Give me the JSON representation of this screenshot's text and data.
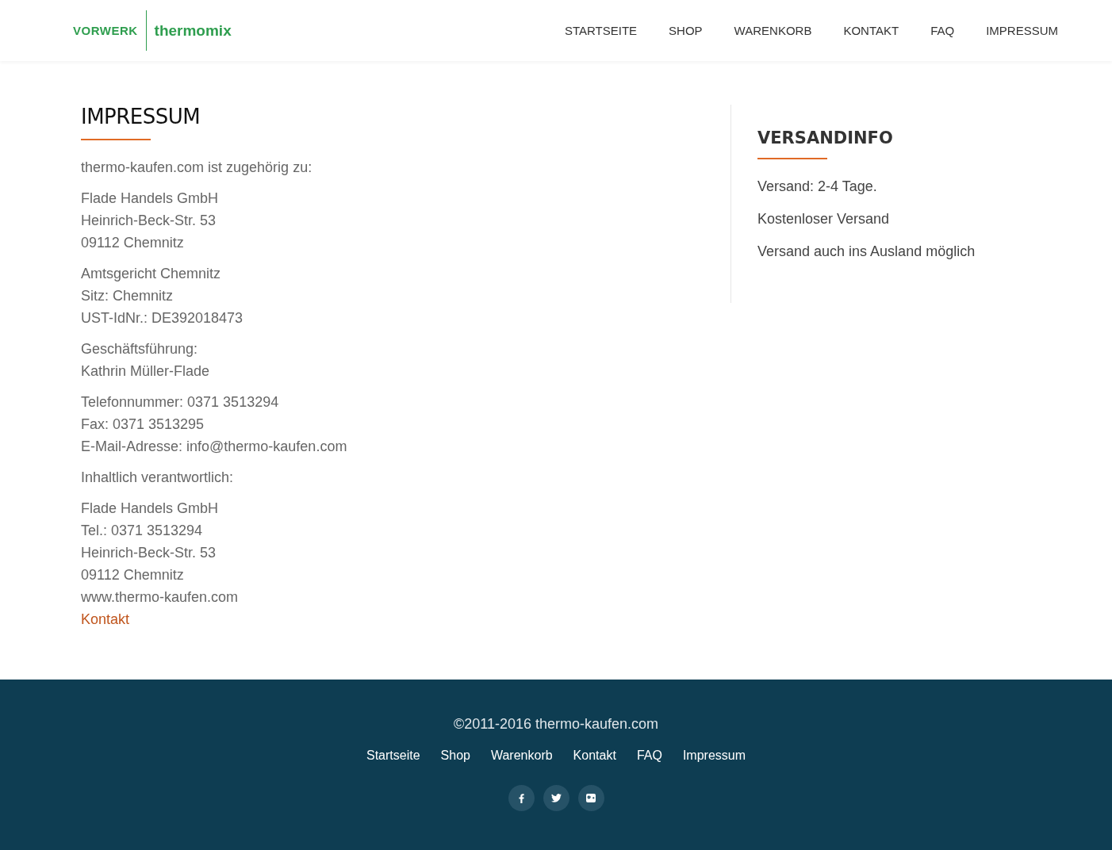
{
  "header": {
    "logo": {
      "brand": "VORWERK",
      "product": "thermomix"
    },
    "nav": [
      {
        "label": "STARTSEITE",
        "selected": false
      },
      {
        "label": "SHOP",
        "selected": false
      },
      {
        "label": "WARENKORB",
        "selected": false
      },
      {
        "label": "KONTAKT",
        "selected": false
      },
      {
        "label": "FAQ",
        "selected": false
      },
      {
        "label": "IMPRESSUM",
        "selected": false
      }
    ]
  },
  "main": {
    "title": "IMPRESSUM",
    "paragraphs": [
      [
        {
          "kind": "text",
          "text": "thermo-kaufen.com ist zugehörig zu:"
        }
      ],
      [
        {
          "kind": "text",
          "text": "Flade Handels GmbH"
        },
        {
          "kind": "text",
          "text": "Heinrich-Beck-Str. 53"
        },
        {
          "kind": "text",
          "text": "09112 Chemnitz"
        }
      ],
      [
        {
          "kind": "text",
          "text": "Amtsgericht Chemnitz"
        },
        {
          "kind": "text",
          "text": "Sitz: Chemnitz"
        },
        {
          "kind": "text",
          "text": "UST-IdNr.: DE392018473"
        }
      ],
      [
        {
          "kind": "text",
          "text": "Geschäftsführung:"
        },
        {
          "kind": "text",
          "text": "Kathrin Müller-Flade"
        }
      ],
      [
        {
          "kind": "text",
          "text": "Telefonnummer: 0371 3513294"
        },
        {
          "kind": "text",
          "text": "Fax: 0371 3513295"
        },
        {
          "kind": "text",
          "text": "E-Mail-Adresse: info@thermo-kaufen.com"
        }
      ],
      [
        {
          "kind": "text",
          "text": "Inhaltlich verantwortlich:"
        }
      ],
      [
        {
          "kind": "text",
          "text": "Flade Handels GmbH"
        },
        {
          "kind": "text",
          "text": "Tel.: 0371 3513294"
        },
        {
          "kind": "text",
          "text": "Heinrich-Beck-Str. 53"
        },
        {
          "kind": "text",
          "text": "09112 Chemnitz"
        },
        {
          "kind": "text",
          "text": "www.thermo-kaufen.com"
        },
        {
          "kind": "link",
          "text": "Kontakt"
        }
      ]
    ]
  },
  "sidebar": {
    "title": "VERSANDINFO",
    "items": [
      "Versand: 2-4 Tage.",
      "Kostenloser Versand",
      "Versand auch ins Ausland möglich"
    ]
  },
  "footer": {
    "copyright": "©2011-2016 thermo-kaufen.com",
    "links": [
      "Startseite",
      "Shop",
      "Warenkorb",
      "Kontakt",
      "FAQ",
      "Impressum"
    ],
    "social": [
      {
        "kind": "facebook"
      },
      {
        "kind": "twitter"
      },
      {
        "kind": "googleplus"
      }
    ]
  }
}
